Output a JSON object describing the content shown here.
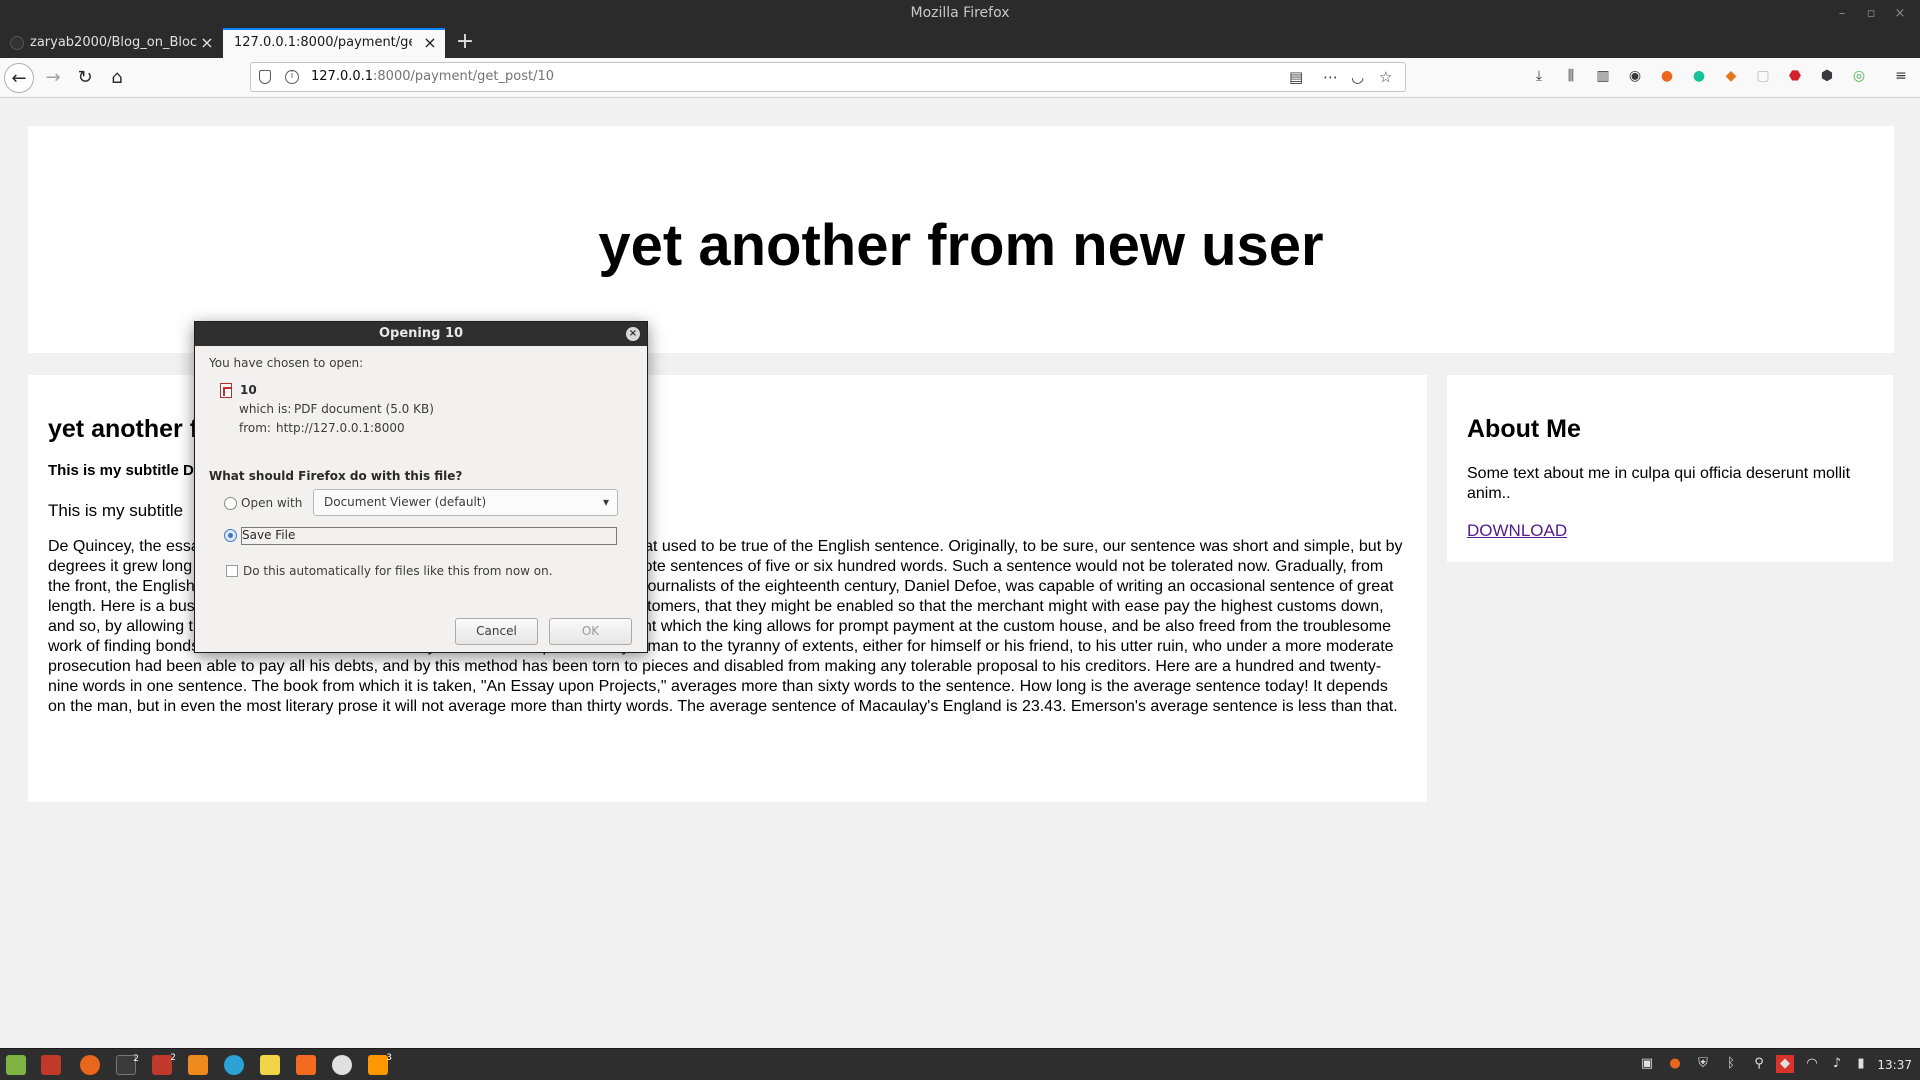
{
  "window": {
    "title": "Mozilla Firefox"
  },
  "tabs": [
    {
      "label": "zaryab2000/Blog_on_Bloc",
      "active": false
    },
    {
      "label": "127.0.0.1:8000/payment/get_p",
      "active": true
    }
  ],
  "nav": {
    "url_host": "127.0.0.1",
    "url_path": ":8000/payment/get_post/10"
  },
  "page": {
    "header_title": "yet another from new user",
    "post": {
      "title": "yet another from new user",
      "subtitle_date": "This is my subtitle Dec 7, 2020",
      "subtitle": "This is my subtitle",
      "body": "De Quincey, the essayist, once remarked that there is always room for one more. That used to be true of the English sentence. Originally, to be sure, our sentence was short and simple, but by degrees it grew long and unwieldy. From sixteenth century writers it is possible to quote sentences of five or six hundred words. Such a sentence would not be tolerated now. Gradually, from the front, the English sentence began to drop a part of its words. Yet one of the best journalists of the eighteenth century, Daniel Defoe, was capable of writing an occasional sentence of great length. Here is a business sentence from Defoe: One office for lone of money for customers, that they might be enabled so that the merchant might with ease pay the highest customs down, and so, by allowing the bank four per cent advance, be first to secure the £10 per cent which the king allows for prompt payment at the custom house, and be also freed from the troublesome work of finding bondsmen and securities for the money - which has exposed many a man to the tyranny of extents, either for himself or his friend, to his utter ruin, who under a more moderate prosecution had been able to pay all his debts, and by this method has been torn to pieces and disabled from making any tolerable proposal to his creditors. Here are a hundred and twenty-nine words in one sentence. The book from which it is taken, \"An Essay upon Projects,\" averages more than sixty words to the sentence. How long is the average sentence today! It depends on the man, but in even the most literary prose it will not average more than thirty words. The average sentence of Macaulay's England is 23.43. Emerson's average sentence is less than that."
    },
    "about": {
      "title": "About Me",
      "text": "Some text about me in culpa qui officia deserunt mollit anim..",
      "link": "DOWNLOAD"
    }
  },
  "dialog": {
    "title": "Opening 10",
    "chosen_label": "You have chosen to open:",
    "filename": "10",
    "which_is_label": "which is:",
    "which_is_value": "PDF document (5.0 KB)",
    "from_label": "from:",
    "from_value": "http://127.0.0.1:8000",
    "question": "What should Firefox do with this file?",
    "open_with_label": "Open with",
    "open_with_value": "Document Viewer (default)",
    "save_file_label": "Save File",
    "auto_label": "Do this automatically for files like this from now on.",
    "cancel_label": "Cancel",
    "ok_label": "OK",
    "selected_option": "save_file"
  },
  "taskbar": {
    "clock": "13:37"
  }
}
